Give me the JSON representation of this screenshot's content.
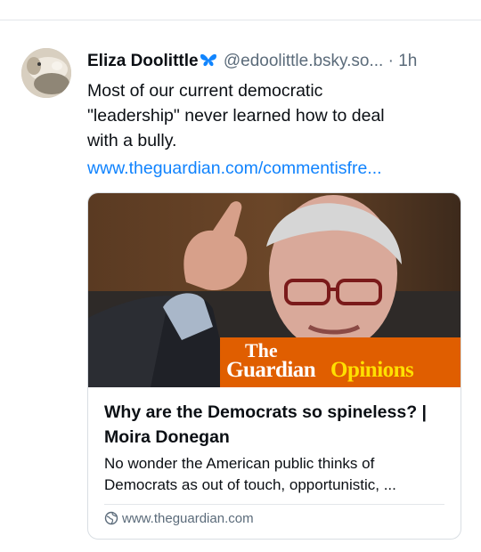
{
  "post": {
    "author": {
      "display_name": "Eliza Doolittle",
      "handle": "@edoolittle.bsky.so...",
      "separator": "·",
      "time": "1h"
    },
    "text_lines": [
      "Most of our current democratic",
      "\"leadership\" never learned how to deal",
      "with a bully."
    ],
    "link": "www.theguardian.com/commentisfre...",
    "card": {
      "image_logo": {
        "the": "The",
        "guardian": "Guardian",
        "opinions": "Opinions"
      },
      "title": "Why are the Democrats so spineless? | Moira Donegan",
      "description": "No wonder the American public thinks of Democrats as out of touch, opportunistic, ...",
      "domain": "www.theguardian.com"
    },
    "icons": {
      "butterfly": "butterfly-icon",
      "globe": "globe-icon"
    },
    "colors": {
      "link": "#1083fe",
      "muted": "#5b6b7a",
      "guardian_orange": "#e05e00",
      "guardian_yellow": "#ffe000"
    }
  }
}
